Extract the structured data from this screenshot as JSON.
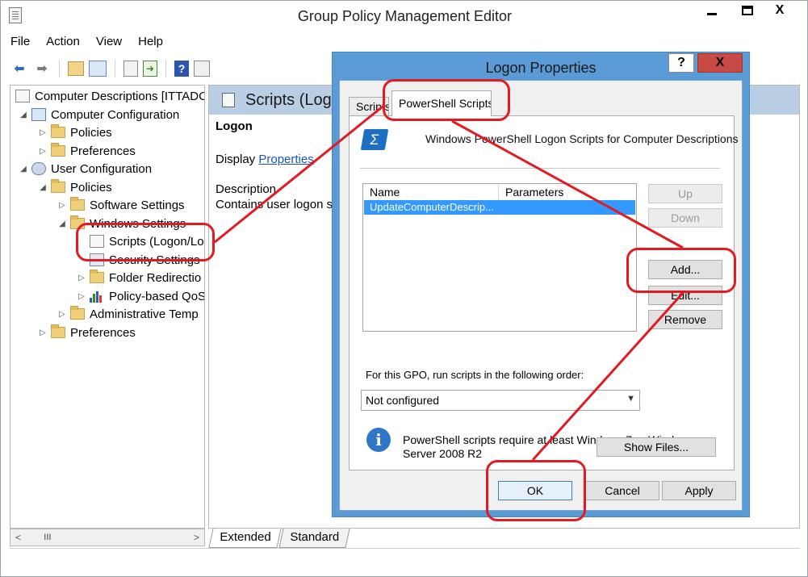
{
  "window": {
    "title": "Group Policy Management Editor",
    "min_label": "",
    "close_label": "X"
  },
  "menu": [
    "File",
    "Action",
    "View",
    "Help"
  ],
  "toolbar": {
    "icons": [
      "back-arrow-icon",
      "forward-arrow-icon",
      "up-folder-icon",
      "show-hide-tree-icon",
      "properties-icon",
      "export-icon",
      "help-icon",
      "filter-icon"
    ],
    "help_glyph": "?"
  },
  "tree": {
    "items": [
      {
        "label": "Computer Descriptions [ITTADC",
        "icon": "doc-icon"
      },
      {
        "label": "Computer Configuration",
        "icon": "computer-icon"
      },
      {
        "label": "Policies",
        "icon": "folder-icon"
      },
      {
        "label": "Preferences",
        "icon": "folder-icon"
      },
      {
        "label": "User Configuration",
        "icon": "user-icon"
      },
      {
        "label": "Policies",
        "icon": "folder-icon"
      },
      {
        "label": "Software Settings",
        "icon": "folder-icon"
      },
      {
        "label": "Windows Settings",
        "icon": "folder-icon"
      },
      {
        "label": "Scripts (Logon/Lo",
        "icon": "script-icon"
      },
      {
        "label": "Security Settings",
        "icon": "security-icon"
      },
      {
        "label": "Folder Redirectio",
        "icon": "folder-icon"
      },
      {
        "label": "Policy-based QoS",
        "icon": "chart-icon"
      },
      {
        "label": "Administrative Temp",
        "icon": "folder-icon"
      },
      {
        "label": "Preferences",
        "icon": "folder-icon"
      }
    ],
    "scroll_thumb": "III"
  },
  "details": {
    "title": "Scripts (Logon",
    "heading": "Logon",
    "display_prefix": "Display ",
    "display_link": "Properties",
    "description_label": "Description",
    "description_text": "Contains user logon sc"
  },
  "view_tabs": [
    "Extended",
    "Standard"
  ],
  "dialog": {
    "title": "Logon Properties",
    "help_label": "?",
    "close_label": "X",
    "tabs": [
      "Scripts",
      "PowerShell Scripts"
    ],
    "heading": "Windows PowerShell Logon Scripts for Computer Descriptions",
    "list": {
      "columns": [
        "Name",
        "Parameters"
      ],
      "rows": [
        {
          "name": "UpdateComputerDescrip...",
          "params": ""
        }
      ]
    },
    "buttons": {
      "up": "Up",
      "down": "Down",
      "add": "Add...",
      "edit": "Edit...",
      "remove": "Remove",
      "show_files": "Show Files...",
      "ok": "OK",
      "cancel": "Cancel",
      "apply": "Apply"
    },
    "order_label": "For this GPO, run scripts in the following order:",
    "order_value": "Not configured",
    "info_text": "PowerShell scripts require at least Windows 7 or Windows Server 2008 R2"
  },
  "annotation_color": "#e21b23"
}
